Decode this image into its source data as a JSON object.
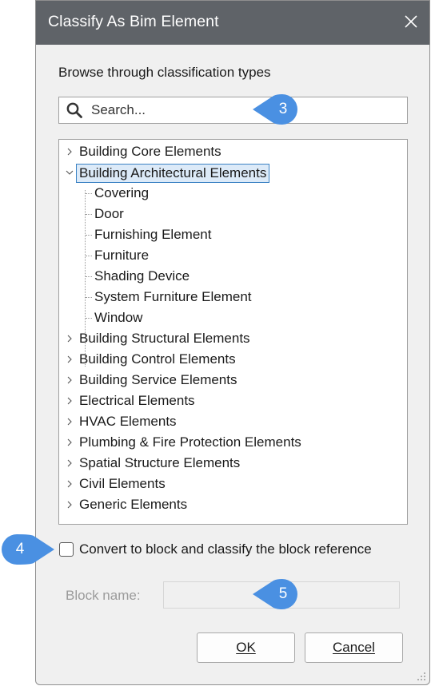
{
  "dialog": {
    "title": "Classify As Bim Element",
    "close_icon": "close-icon"
  },
  "browse_label": "Browse through classification types",
  "search": {
    "placeholder": "Search...",
    "value": "",
    "icon": "search-icon"
  },
  "tree": {
    "items": [
      {
        "label": "Building Core Elements",
        "expanded": false
      },
      {
        "label": "Building Architectural Elements",
        "expanded": true,
        "selected": true,
        "children": [
          "Covering",
          "Door",
          "Furnishing Element",
          "Furniture",
          "Shading Device",
          "System Furniture Element",
          "Window"
        ]
      },
      {
        "label": "Building Structural Elements",
        "expanded": false
      },
      {
        "label": "Building Control Elements",
        "expanded": false
      },
      {
        "label": "Building Service Elements",
        "expanded": false
      },
      {
        "label": "Electrical Elements",
        "expanded": false
      },
      {
        "label": "HVAC Elements",
        "expanded": false
      },
      {
        "label": "Plumbing & Fire Protection Elements",
        "expanded": false
      },
      {
        "label": "Spatial Structure Elements",
        "expanded": false
      },
      {
        "label": "Civil Elements",
        "expanded": false
      },
      {
        "label": "Generic Elements",
        "expanded": false
      }
    ]
  },
  "convert_checkbox": {
    "label": "Convert to block and classify the block reference",
    "checked": false
  },
  "block_name": {
    "label": "Block name:",
    "value": "",
    "enabled": false
  },
  "buttons": {
    "ok": "OK",
    "cancel": "Cancel"
  },
  "callouts": [
    "3",
    "4",
    "5"
  ],
  "colors": {
    "titlebar": "#5f6368",
    "callout": "#4a90e2",
    "selection_border": "#3b82c4",
    "selection_fill": "#dceaf8"
  }
}
